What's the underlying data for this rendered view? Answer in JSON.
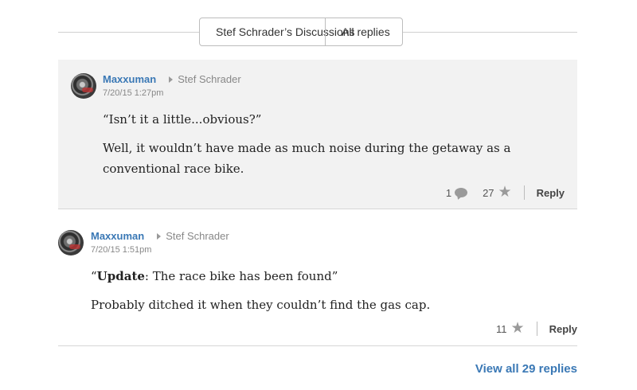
{
  "tabs": [
    "Stef Schrader’s Discussions",
    "All replies"
  ],
  "replies": [
    {
      "author": "Maxxuman",
      "in_reply_to": "Stef Schrader",
      "timestamp": "7/20/15 1:27pm",
      "quote": "“Isn’t it a little...obvious?”",
      "body": "Well, it wouldn’t have made as much noise during the getaway as a conventional race bike.",
      "comment_count": "1",
      "star_count": "27",
      "reply_label": "Reply"
    },
    {
      "author": "Maxxuman",
      "in_reply_to": "Stef Schrader",
      "timestamp": "7/20/15 1:51pm",
      "quote_open": "“",
      "quote_bold": "Update",
      "quote_rest": ": The race bike has been found”",
      "body": "Probably ditched it when they couldn’t find the gas cap.",
      "star_count": "11",
      "reply_label": "Reply"
    }
  ],
  "view_all": "View all 29 replies",
  "icons": {
    "comment": "comment-bubble-icon",
    "star": "star-icon",
    "reply_arrow": "reply-arrow-icon"
  },
  "colors": {
    "link": "#3a78b5",
    "shaded_bg": "#f2f2f2"
  }
}
